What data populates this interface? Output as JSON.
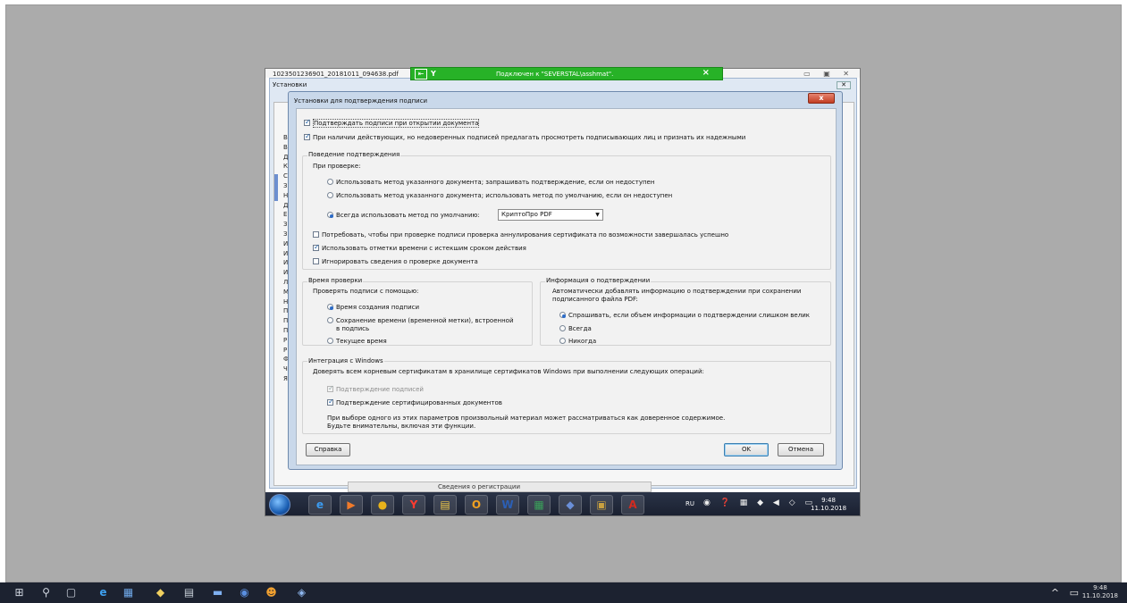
{
  "remote": {
    "bg_title": "1023501236901_20181011_094638.pdf",
    "ust_title": "Установки",
    "ust_list_letters": [
      "В",
      "В",
      "Д",
      "К",
      "С",
      "З",
      "Н",
      "Д",
      "Е",
      "З",
      "З",
      "И",
      "И",
      "И",
      "И",
      "Л",
      "М",
      "Н",
      "П",
      "П",
      "П",
      "Р",
      "Р",
      "Ф",
      "Ч",
      "Я"
    ],
    "strip_text": "Сведения о регистрации",
    "lang": "RU",
    "clock_time": "9:48",
    "clock_date": "11.10.2018",
    "apps": [
      {
        "icon": "ie-icon",
        "glyph": "e",
        "color": "#3b9bf0"
      },
      {
        "icon": "media-player-icon",
        "glyph": "▶",
        "color": "#f07a2a"
      },
      {
        "icon": "chrome-icon",
        "glyph": "●",
        "color": "#e8b21a"
      },
      {
        "icon": "yandex-browser-icon",
        "glyph": "Y",
        "color": "#ff3b30"
      },
      {
        "icon": "file-explorer-icon",
        "glyph": "▤",
        "color": "#f0c94a"
      },
      {
        "icon": "outlook-icon",
        "glyph": "O",
        "color": "#f0a020"
      },
      {
        "icon": "word-icon",
        "glyph": "W",
        "color": "#2b5fb5"
      },
      {
        "icon": "spreadsheet-app-icon",
        "glyph": "▦",
        "color": "#3aa05a"
      },
      {
        "icon": "network-app-icon",
        "glyph": "◆",
        "color": "#6a8fd8"
      },
      {
        "icon": "archive-app-icon",
        "glyph": "▣",
        "color": "#c8a040"
      },
      {
        "icon": "acrobat-icon",
        "glyph": "A",
        "color": "#d32a1f"
      }
    ]
  },
  "rdp": {
    "signal": "Y",
    "text": "Подключен к \"SEVERSTAL\\asshmat\".",
    "close": "×"
  },
  "dialog": {
    "title": "Установки для подтверждения подписи",
    "close": "x",
    "verify_on_open": {
      "label": "Подтверждать подписи при открытии документа",
      "checked": true
    },
    "prompt_untrusted": {
      "label": "При наличии действующих, но недоверенных подписей предлагать просмотреть подписывающих лиц и признать их надежными",
      "checked": true
    },
    "behavior": {
      "title": "Поведение подтверждения",
      "subtitle": "При проверке:",
      "options": [
        {
          "label": "Использовать метод указанного документа; запрашивать подтверждение, если он недоступен",
          "selected": false
        },
        {
          "label": "Использовать метод указанного документа; использовать метод по умолчанию, если он недоступен",
          "selected": false
        },
        {
          "label": "Всегда использовать метод по умолчанию:",
          "selected": true
        }
      ],
      "default_method": "КриптоПро PDF",
      "require_revocation": {
        "label": "Потребовать, чтобы при проверке подписи проверка аннулирования сертификата по возможности завершалась успешно",
        "checked": false
      },
      "expired_timestamps": {
        "label": "Использовать отметки времени с истекшим сроком действия",
        "checked": true
      },
      "ignore_info": {
        "label": "Игнорировать сведения о проверке документа",
        "checked": false
      }
    },
    "time": {
      "title": "Время проверки",
      "subtitle": "Проверять подписи с помощью:",
      "options": [
        {
          "label": "Время создания подписи",
          "selected": true
        },
        {
          "label": "Сохранение времени (временной метки), встроенной",
          "label2": "в подпись",
          "selected": false
        },
        {
          "label": "Текущее время",
          "selected": false
        }
      ]
    },
    "info": {
      "title": "Информация о подтверждении",
      "subtitle": "Автоматически добавлять информацию о подтверждении при сохранении",
      "subtitle2": "подписанного файла PDF:",
      "options": [
        {
          "label": "Спрашивать, если объем информации о подтверждении слишком велик",
          "selected": true
        },
        {
          "label": "Всегда",
          "selected": false
        },
        {
          "label": "Никогда",
          "selected": false
        }
      ]
    },
    "windows": {
      "title": "Интеграция с Windows",
      "subtitle": "Доверять всем корневым сертификатам в хранилище сертификатов Windows при выполнении следующих операций:",
      "sig_validation": {
        "label": "Подтверждение подписей",
        "checked": true,
        "disabled": true
      },
      "cert_docs": {
        "label": "Подтверждение сертифицированных документов",
        "checked": true
      },
      "note1": "При выборе одного из этих параметров произвольный материал может рассматриваться как доверенное содержимое.",
      "note2": "Будьте внимательны, включая эти функции."
    },
    "help_button": "Справка",
    "ok_button": "OK",
    "cancel_button": "Отмена"
  },
  "host": {
    "clock_time": "9:48",
    "clock_date": "11.10.2018"
  }
}
